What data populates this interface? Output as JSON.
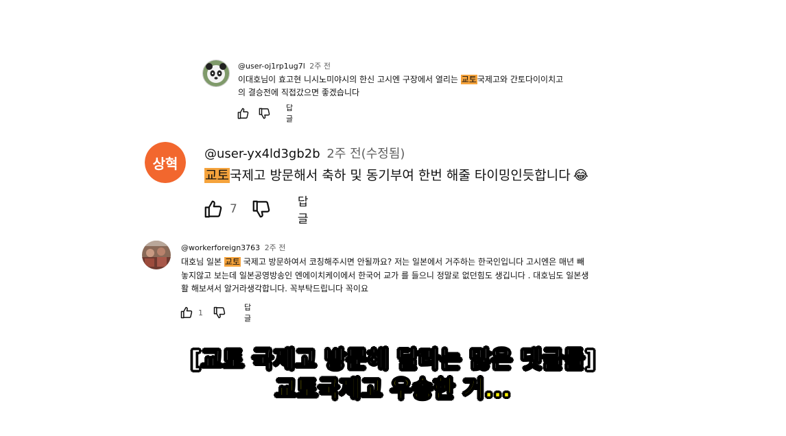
{
  "comments": [
    {
      "handle": "@user-oj1rp1ug7l",
      "time": "2주 전",
      "lines": [
        {
          "pre": "이대호님이 효고현 니시노미야시의 한신 고시엔 구장에서 열리는 ",
          "hl": "교토",
          "post": "국제고와 간토다이이치고"
        },
        {
          "pre": "의 결승전에 직접갔으면 좋겠습니다",
          "hl": "",
          "post": ""
        }
      ],
      "likes": "",
      "reply_label": "답글"
    },
    {
      "handle": "@user-yx4ld3gb2b",
      "time": "2주 전(수정됨)",
      "avatar_text": "상혁",
      "avatar_color": "#f2672e",
      "hl": "교토",
      "post": "국제고 방문해서 축하 및 동기부여 한번 해줄 타이밍인듯합니다",
      "emoji": "😂",
      "likes": "7",
      "reply_label": "답글"
    },
    {
      "handle": "@workerforeign3763",
      "time": "2주 전",
      "lines": [
        {
          "pre": "대호님 일본 ",
          "hl": "교토",
          "post": " 국제고 방문하여서 코칭해주시면 안될까요? 저는 일본에서 거주하는 한국인입니다 고시엔은 매년 빼"
        },
        {
          "pre": "놓지않고 보는데 일본공영방송인 엔에이치케이에서 한국어 교가 를 들으니 정말로 없던힘도 생깁니다 . 대호님도 일본생",
          "hl": "",
          "post": ""
        },
        {
          "pre": "활 해보셔서 알거라생각합니다. 꼭부탁드립니다 꼭이요",
          "hl": "",
          "post": ""
        }
      ],
      "likes": "1",
      "reply_label": "답글"
    }
  ],
  "captions": {
    "line1": "[교토 국제고 방문해 달라는 많은 댓글들]",
    "line2": "교토국제고 우승한 거..."
  },
  "colors": {
    "highlight": "#f5a33c",
    "caption_line1": "#ffffff",
    "caption_line2": "#fff200",
    "muted": "#606060"
  },
  "icons": [
    "like-icon",
    "dislike-icon"
  ]
}
